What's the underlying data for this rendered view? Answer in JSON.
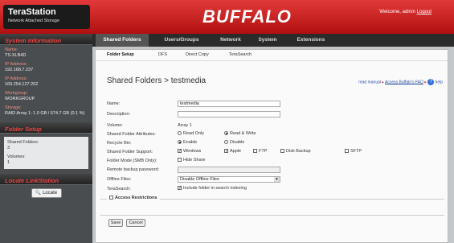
{
  "header": {
    "logo_title": "TeraStation",
    "logo_subtitle": "Network Attached Storage",
    "brand": "BUFFALO",
    "welcome_text": "Welcome, admin",
    "logout_label": "Logout"
  },
  "sidebar": {
    "system_info_title": "System Information",
    "items": [
      {
        "label": "Name:",
        "value": "TS-XLB4D"
      },
      {
        "label": "IP Address:",
        "value": "192.168.7.237"
      },
      {
        "label": "IP Address:",
        "value": "169.254.127.202"
      },
      {
        "label": "Workgroup:",
        "value": "WORKGROUP"
      },
      {
        "label": "Storage:",
        "value": "RAID Array 1: 1.0 GB / 674.7 GB (0.1 %)"
      }
    ],
    "folder_setup_title": "Folder Setup",
    "shared_folders_label": "Shared Folders:",
    "shared_folders_value": "3",
    "volumes_label": "Volumes:",
    "volumes_value": "1",
    "locate_title": "Locate LinkStation",
    "locate_button": "Locate"
  },
  "topnav": {
    "tabs": [
      "Shared Folders",
      "Users/Groups",
      "Network",
      "System",
      "Extensions"
    ]
  },
  "subnav": {
    "tabs": [
      "Folder Setup",
      "DFS",
      "Direct Copy",
      "TeraSearch"
    ]
  },
  "main": {
    "title": "Shared Folders > testmedia",
    "read_manual": "read manual",
    "buffalo_faq": "Access Buffalo's FAQ",
    "help": "help",
    "form": {
      "name_label": "Name:",
      "name_value": "testmedia",
      "description_label": "Description:",
      "description_value": "",
      "volume_label": "Volume:",
      "volume_value": "Array 1",
      "attributes_label": "Shared Folder Attributes:",
      "read_only": "Read Only",
      "read_write": "Read & Write",
      "recycle_label": "Recycle Bin:",
      "enable": "Enable",
      "disable": "Disable",
      "support_label": "Shared Folder Support:",
      "windows": "Windows",
      "apple": "Apple",
      "ftp": "FTP",
      "disk_backup": "Disk Backup",
      "sftp": "SFTP",
      "smb_label": "Folder Mode (SMB Only):",
      "hide_share": "Hide Share",
      "remote_label": "Remote backup password:",
      "offline_label": "Offline Files:",
      "offline_value": "Disable Offline Files",
      "terasearch_label": "TeraSearch:",
      "terasearch_option": "Include folder in search indexing",
      "access_restrictions": "Access Restrictions"
    },
    "save_button": "Save",
    "cancel_button": "Cancel"
  }
}
